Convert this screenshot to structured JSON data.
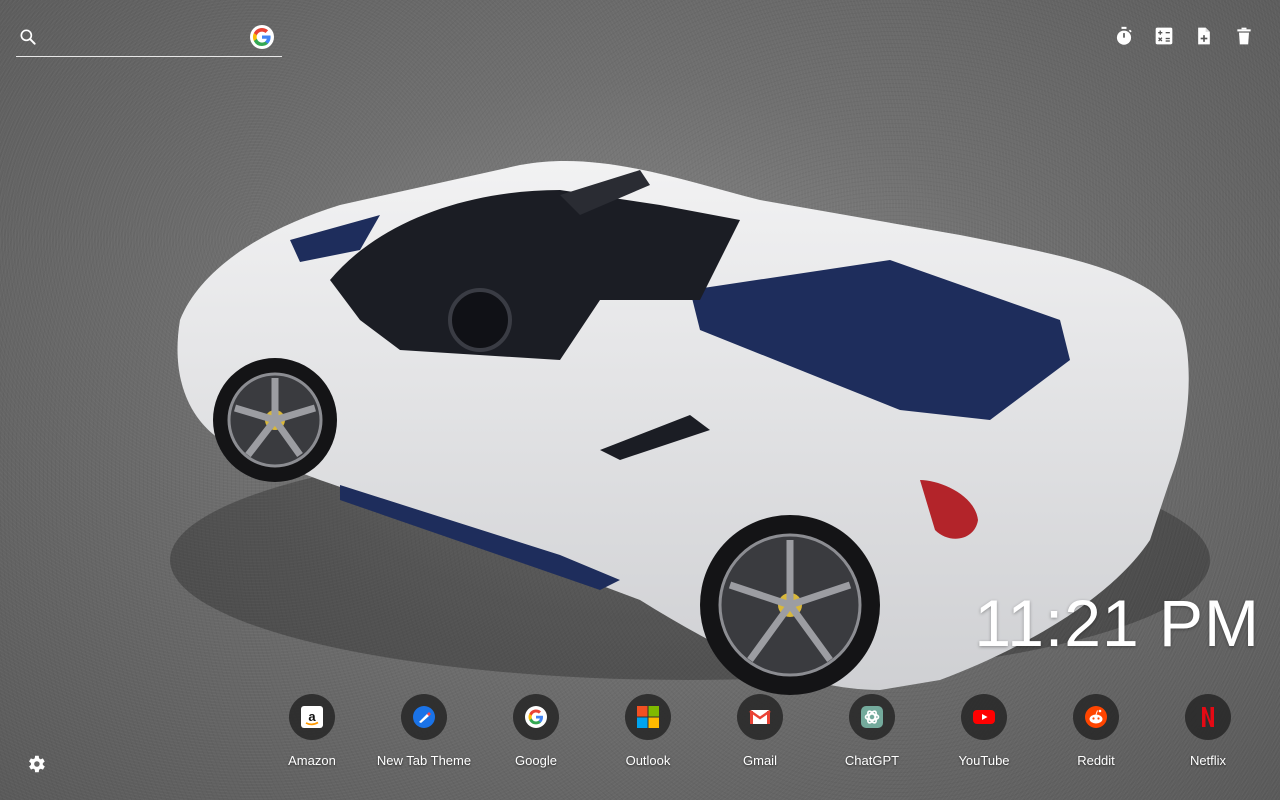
{
  "search": {
    "placeholder": "",
    "value": "",
    "engine_icon": "google-icon"
  },
  "toolbar": {
    "icons": [
      "timer-icon",
      "calculator-icon",
      "add-note-icon",
      "trash-icon"
    ]
  },
  "clock": {
    "time": "11:21 PM"
  },
  "shortcuts": [
    {
      "label": "Amazon",
      "icon": "amazon-icon"
    },
    {
      "label": "New Tab Theme",
      "icon": "new-tab-theme-icon"
    },
    {
      "label": "Google",
      "icon": "google-icon"
    },
    {
      "label": "Outlook",
      "icon": "outlook-icon"
    },
    {
      "label": "Gmail",
      "icon": "gmail-icon"
    },
    {
      "label": "ChatGPT",
      "icon": "chatgpt-icon"
    },
    {
      "label": "YouTube",
      "icon": "youtube-icon"
    },
    {
      "label": "Reddit",
      "icon": "reddit-icon"
    },
    {
      "label": "Netflix",
      "icon": "netflix-icon"
    }
  ],
  "settings": {
    "icon": "gear-icon"
  },
  "wallpaper": {
    "subject": "ferrari-convertible-icon",
    "accent": "#1e2d5c",
    "body_color": "#e4e4e6"
  }
}
